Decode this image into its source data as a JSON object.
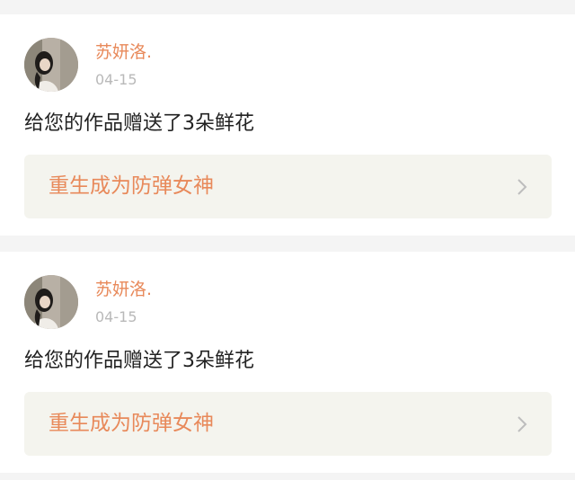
{
  "notifications": [
    {
      "user": "苏妍洛.",
      "date": "04-15",
      "message": "给您的作品赠送了3朵鲜花",
      "work_title": "重生成为防弹女神",
      "chevron_icon": "chevron-right-icon"
    },
    {
      "user": "苏妍洛.",
      "date": "04-15",
      "message": "给您的作品赠送了3朵鲜花",
      "work_title": "重生成为防弹女神",
      "chevron_icon": "chevron-right-icon"
    }
  ],
  "colors": {
    "accent": "#e8895a",
    "background": "#f4f4f4",
    "card": "#ffffff",
    "link_box": "#f4f4ee",
    "date": "#b9b9b9",
    "text": "#222222"
  }
}
